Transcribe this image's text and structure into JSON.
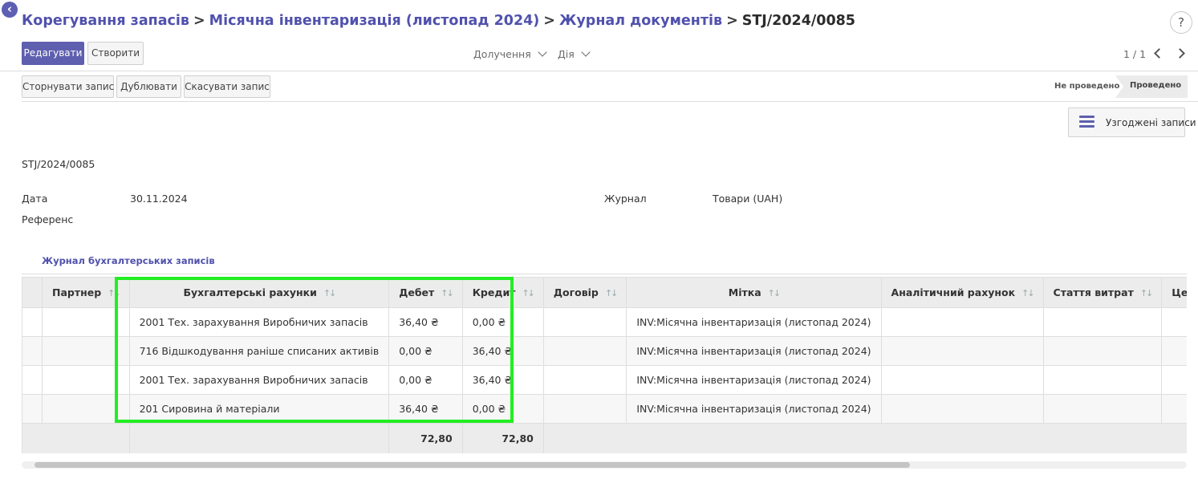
{
  "breadcrumb": {
    "items": [
      "Корегування запасів",
      "Місячна інвентаризація (листопад 2024)",
      "Журнал документів"
    ],
    "current": "STJ/2024/0085"
  },
  "help_label": "?",
  "toolbar": {
    "edit_label": "Редагувати",
    "create_label": "Створити",
    "attachments_label": "Долучення",
    "action_label": "Дія",
    "pager": "1 / 1"
  },
  "actions": {
    "reverse_label": "Сторнувати запис",
    "duplicate_label": "Дублювати",
    "cancel_label": "Скасувати запис"
  },
  "status": {
    "draft": "Не проведено",
    "posted": "Проведено"
  },
  "reconciled_button": "Узгоджені записи",
  "form": {
    "name": "STJ/2024/0085",
    "date_label": "Дата",
    "date_value": "30.11.2024",
    "journal_label": "Журнал",
    "journal_value": "Товари (UAH)",
    "reference_label": "Референс"
  },
  "tab": "Журнал бухгалтерських записів",
  "table": {
    "headers": [
      "Партнер",
      "Бухгалтерські рахунки",
      "Дебет",
      "Кредит",
      "Договір",
      "Мітка",
      "Аналітичний рахунок",
      "Стаття витрат",
      "Центр витрат"
    ],
    "rows": [
      {
        "partner": "",
        "account": "2001 Тех. зарахування Виробничих запасів",
        "debit": "36,40 ₴",
        "credit": "0,00 ₴",
        "contract": "",
        "label": "INV:Місячна інвентаризація (листопад 2024)"
      },
      {
        "partner": "",
        "account": "716 Відшкодування раніше списаних активів",
        "debit": "0,00 ₴",
        "credit": "36,40 ₴",
        "contract": "",
        "label": "INV:Місячна інвентаризація (листопад 2024)"
      },
      {
        "partner": "",
        "account": "2001 Тех. зарахування Виробничих запасів",
        "debit": "0,00 ₴",
        "credit": "36,40 ₴",
        "contract": "",
        "label": "INV:Місячна інвентаризація (листопад 2024)"
      },
      {
        "partner": "",
        "account": "201 Сировина й матеріали",
        "debit": "36,40 ₴",
        "credit": "0,00 ₴",
        "contract": "",
        "label": "INV:Місячна інвентаризація (листопад 2024)"
      }
    ],
    "totals": {
      "debit": "72,80",
      "credit": "72,80"
    }
  },
  "colors": {
    "accent": "#5e5fae",
    "highlight": "#22ee22"
  }
}
